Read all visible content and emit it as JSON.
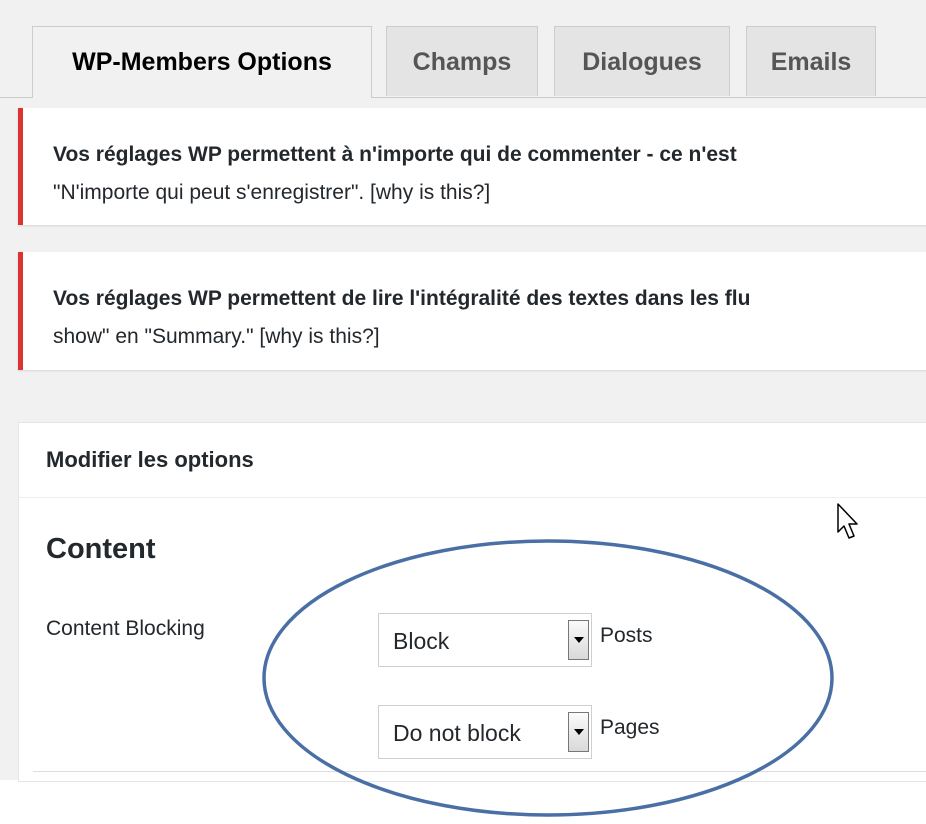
{
  "tabs": [
    {
      "label": "WP-Members Options",
      "active": true
    },
    {
      "label": "Champs",
      "active": false
    },
    {
      "label": "Dialogues",
      "active": false
    },
    {
      "label": "Emails",
      "active": false
    }
  ],
  "notices": [
    {
      "line1": "Vos réglages WP permettent à n'importe qui de commenter - ce n'est",
      "line2": "\"N'importe qui peut s'enregistrer\". [why is this?]"
    },
    {
      "line1": "Vos réglages WP permettent de lire l'intégralité des textes dans les flu",
      "line2": "show\" en \"Summary.\" [why is this?]"
    }
  ],
  "options_panel": {
    "title": "Modifier les options",
    "section_title": "Content",
    "content_blocking": {
      "label": "Content Blocking",
      "posts": {
        "selected": "Block",
        "suffix": "Posts"
      },
      "pages": {
        "selected": "Do not block",
        "suffix": "Pages"
      }
    }
  },
  "colors": {
    "notice_error_border": "#dc3232",
    "annotation_ellipse": "#4a6fa5",
    "admin_background": "#f1f1f1"
  }
}
